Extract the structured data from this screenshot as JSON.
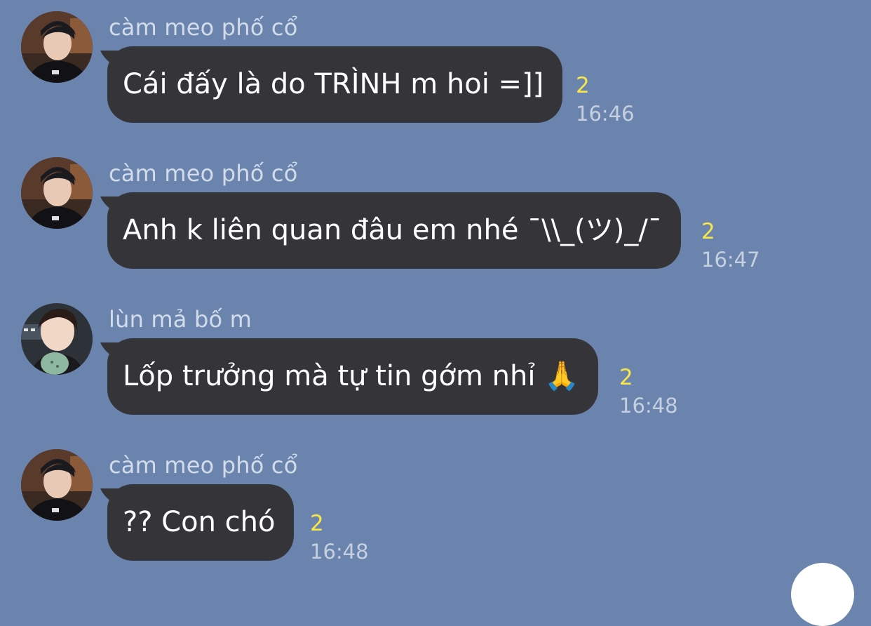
{
  "messages": [
    {
      "sender": "càm meo phố cổ",
      "text": "Cái đấy là do TRÌNH m hoi =]]",
      "read_count": "2",
      "time": "16:46"
    },
    {
      "sender": "càm meo phố cổ",
      "text": "Anh k liên quan đâu em nhé ¯\\\\_(ツ)_/¯",
      "read_count": "2",
      "time": "16:47"
    },
    {
      "sender": "lùn mả bố m",
      "text": "Lốp trưởng mà tự tin gớm nhỉ",
      "emoji": "🙏",
      "read_count": "2",
      "time": "16:48"
    },
    {
      "sender": "càm meo phố cổ",
      "text": "?? Con chó",
      "read_count": "2",
      "time": "16:48"
    }
  ],
  "colors": {
    "background": "#6a84ad",
    "bubble": "#353539",
    "read_count": "#f7e64b",
    "time": "#c6d0e0",
    "sender": "#d3dcea"
  }
}
